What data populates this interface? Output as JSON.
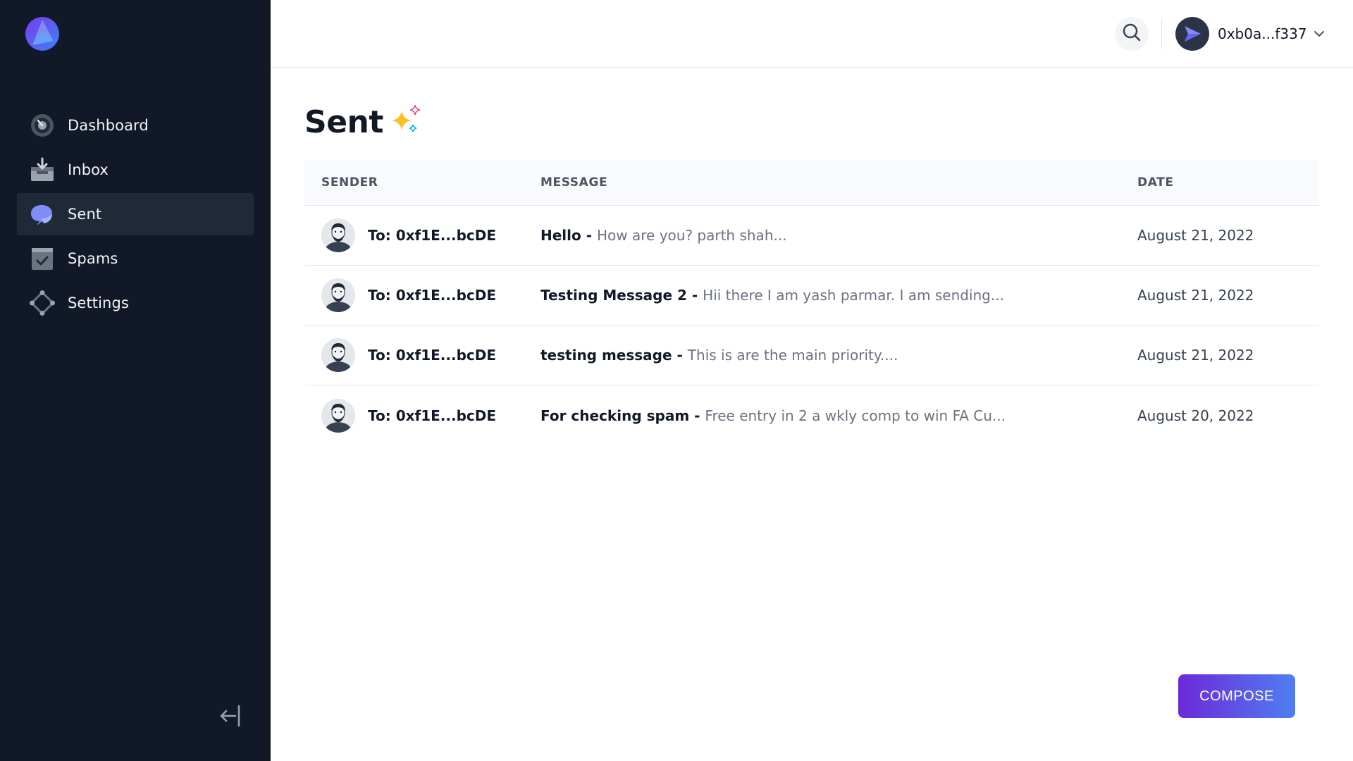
{
  "brand": {
    "logo_icon": "app-logo-icon"
  },
  "sidebar": {
    "items": [
      {
        "label": "Dashboard",
        "icon": "dashboard-icon",
        "active": false
      },
      {
        "label": "Inbox",
        "icon": "inbox-icon",
        "active": false
      },
      {
        "label": "Sent",
        "icon": "chat-bubble-icon",
        "active": true
      },
      {
        "label": "Spams",
        "icon": "spam-clipboard-icon",
        "active": false
      },
      {
        "label": "Settings",
        "icon": "settings-nodes-icon",
        "active": false
      }
    ],
    "collapse_icon": "collapse-arrow-left-icon"
  },
  "header": {
    "search_icon": "search-icon",
    "account": {
      "name": "0xb0a...f337",
      "avatar_icon": "send-arrow-icon",
      "chevron_icon": "chevron-down-icon"
    }
  },
  "page": {
    "title": "Sent",
    "title_icon": "sparkles-icon"
  },
  "table": {
    "headers": {
      "sender": "SENDER",
      "message": "MESSAGE",
      "date": "DATE"
    },
    "rows": [
      {
        "to": "To: 0xf1E...bcDE",
        "subject": "Hello",
        "sep": " - ",
        "preview": "How are you? parth shah...",
        "date": "August 21, 2022"
      },
      {
        "to": "To: 0xf1E...bcDE",
        "subject": "Testing Message 2",
        "sep": " - ",
        "preview": "Hii there I am yash parmar. I am sending...",
        "date": "August 21, 2022"
      },
      {
        "to": "To: 0xf1E...bcDE",
        "subject": "testing message",
        "sep": " - ",
        "preview": "This is are the main priority....",
        "date": "August 21, 2022"
      },
      {
        "to": "To: 0xf1E...bcDE",
        "subject": "For checking spam",
        "sep": " - ",
        "preview": "Free entry in 2 a wkly comp to win FA Cu...",
        "date": "August 20, 2022"
      }
    ]
  },
  "compose": {
    "label": "COMPOSE"
  },
  "colors": {
    "sidebar_bg": "#111827",
    "sidebar_active": "#1f2937",
    "accent_start": "#6d28d9",
    "accent_end": "#4f7ff2"
  }
}
